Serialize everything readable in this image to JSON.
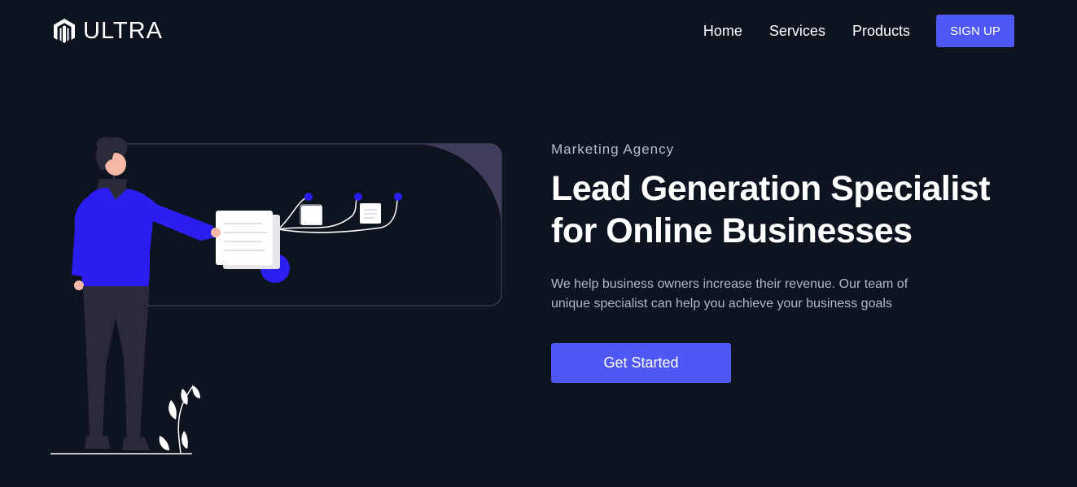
{
  "nav": {
    "brand_name": "ULTRA",
    "brand_icon": "magento-logo-icon",
    "links": [
      "Home",
      "Services",
      "Products"
    ],
    "signup_label": "SIGN UP"
  },
  "hero": {
    "eyebrow": "Marketing Agency",
    "headline_line1": "Lead Generation Specialist",
    "headline_line2": "for Online Businesses",
    "description": "We help business owners increase their revenue. Our team of unique specialist can help you achieve your business goals",
    "cta_label": "Get Started"
  },
  "colors": {
    "background": "#0e1320",
    "accent": "#4f57f5",
    "illustration_blue": "#2a1ff0",
    "text_muted": "#b3b8c8"
  }
}
